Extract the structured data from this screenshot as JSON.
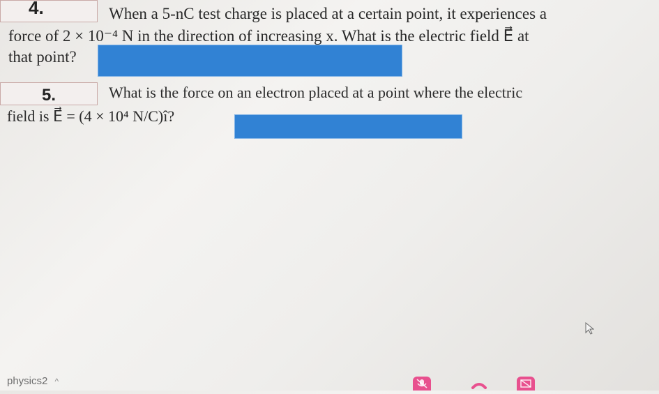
{
  "question4": {
    "number": "4.",
    "line1": "When a 5-nC test charge is placed at a certain point, it experiences a",
    "line2": "force of 2 × 10⁻⁴ N in the direction of increasing x. What is the electric field E⃗ at",
    "line3": "that point?"
  },
  "question5": {
    "number": "5.",
    "line1": "What is the force on an electron placed at a point where the electric",
    "line2": "field is E⃗ = (4 × 10⁴ N/C)î?"
  },
  "footer": {
    "tab_label": "physics2",
    "chevron": "^"
  },
  "icons": {
    "mic": "mic-icon",
    "phone": "phone-icon",
    "screen": "screen-share-icon",
    "cursor": "cursor-icon"
  },
  "colors": {
    "answer_box": "#3182d4",
    "call_tools": "#e8508e"
  }
}
